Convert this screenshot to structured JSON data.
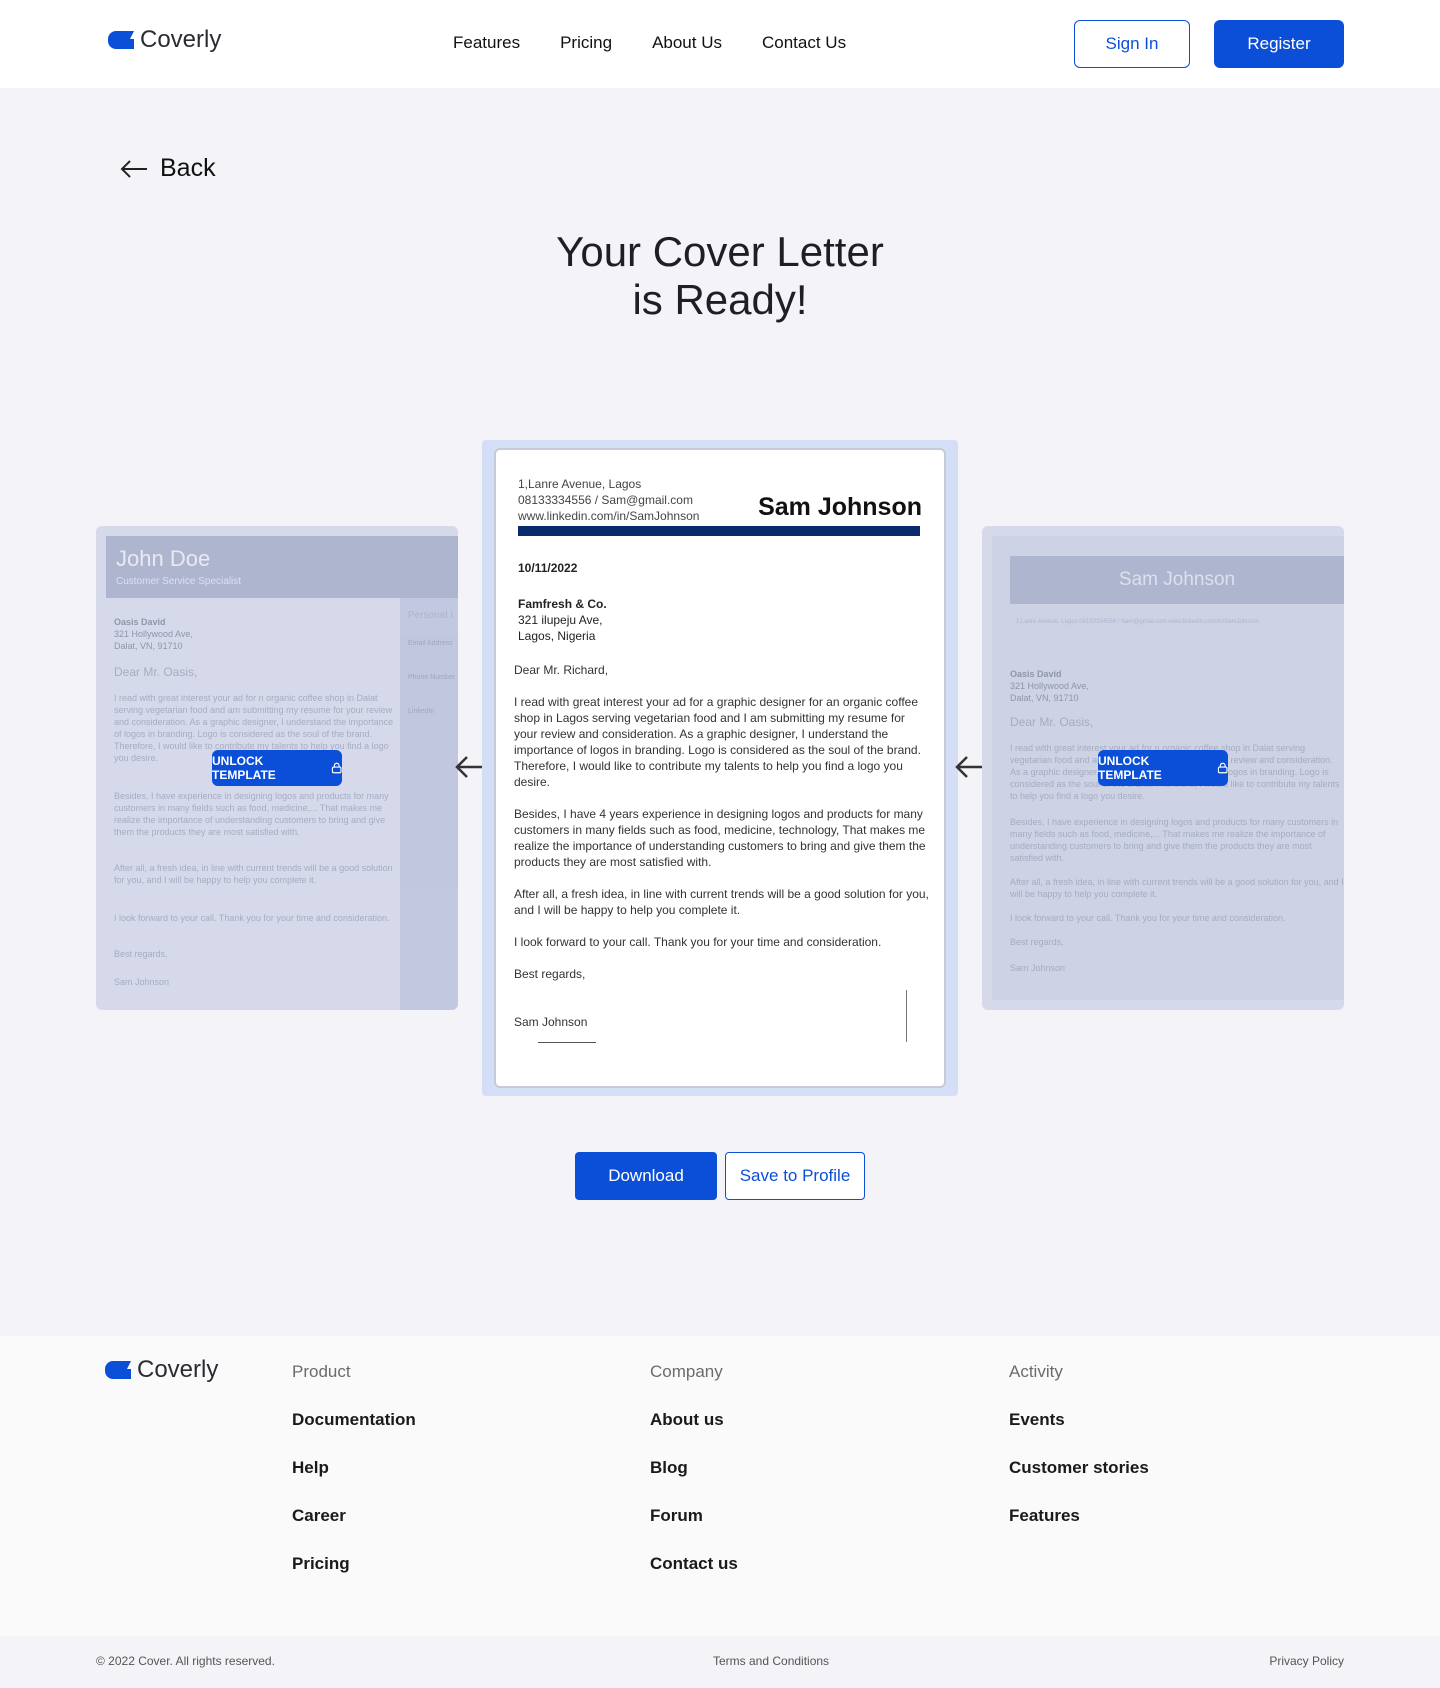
{
  "header": {
    "brand": "Coverly",
    "nav": [
      "Features",
      "Pricing",
      "About Us",
      "Contact Us"
    ],
    "sign_in": "Sign In",
    "register": "Register"
  },
  "page": {
    "back": "Back",
    "title_line1": "Your Cover Letter",
    "title_line2": "is Ready!"
  },
  "left_template": {
    "name": "John Doe",
    "role": "Customer Service Specialist",
    "side_heading": "Personal I",
    "side_fields": [
      "Email Address",
      "Phone Number",
      "LinkedIn"
    ],
    "recipient": [
      "Oasis David",
      "321 Hollywood Ave,",
      "Dalat, VN, 91710"
    ],
    "greeting": "Dear Mr. Oasis,",
    "paras": [
      "I read with great interest your ad for n organic coffee shop in Dalat serving vegetarian food and am submitting my resume for your review and consideration. As a graphic designer, I understand the importance of logos in branding. Logo is considered as the soul of the brand. Therefore, I would like to contribute my talents to help you find a logo you desire.",
      "Besides, I have experience in designing logos and products for many customers in many fields such as food, medicine,... That makes me realize the importance of understanding customers to bring and give them the products they are most satisfied with.",
      "After all, a fresh idea, in line with current trends will be a good solution for you, and I will be happy to help you complete it.",
      "I look forward to your call. Thank you for your time and consideration."
    ],
    "closing": "Best regards,",
    "signature": "Sam Johnson",
    "unlock": "UNLOCK TEMPLATE"
  },
  "right_template": {
    "name": "Sam Johnson",
    "contact": "1,Lanre Avenue, Lagos  08133334556 / Sam@gmail.com  www.linkedin.com/in/SamJohnson",
    "recipient": [
      "Oasis David",
      "321 Hollywood Ave,",
      "Dalat, VN, 91710"
    ],
    "greeting": "Dear Mr. Oasis,",
    "paras": [
      "I read with great interest your ad for n organic coffee shop in Dalat serving vegetarian food and am submitting my resume for your review and consideration. As a graphic designer, I understand the importance of logos in branding. Logo is considered as the soul of the brand. Therefore, I would like to contribute my talents to help you find a logo you desire.",
      "Besides, I have experience in designing logos and products for many customers in many fields such as food, medicine,... That makes me realize the importance of understanding customers to bring and give them the products they are most satisfied with.",
      "After all, a fresh idea, in line with current trends will be a good solution for you, and I will be happy to help you complete it.",
      "I look forward to your call. Thank you for your time and consideration."
    ],
    "closing": "Best regards,",
    "signature": "Sam Johnson",
    "unlock": "UNLOCK TEMPLATE"
  },
  "letter": {
    "address": "1,Lanre Avenue, Lagos",
    "phone_email": "08133334556 / Sam@gmail.com",
    "linkedin": "www.linkedin.com/in/SamJohnson",
    "name": "Sam Johnson",
    "date": "10/11/2022",
    "company": "Famfresh & Co.",
    "company_street": "321 ilupeju  Ave,",
    "company_city": "Lagos, Nigeria",
    "greeting": "Dear Mr. Richard,",
    "p1": "I read with great interest your ad for a graphic designer for an organic coffee shop in Lagos serving vegetarian food and I am submitting my resume for your review and consideration. As a graphic designer, I understand the importance of logos in branding. Logo is considered as the soul of the brand. Therefore, I would like to contribute my talents to help you find a logo you desire.",
    "p2": "Besides, I have 4 years experience in designing logos and products for many customers in many fields such as food, medicine, technology, That makes me realize the importance of understanding customers to bring and give them the products they are most satisfied with.",
    "p3": "After all, a fresh idea, in line with current trends will be a good solution for you, and I will be happy to help you complete it.",
    "p4": "I look forward to your call. Thank you for your time and consideration.",
    "closing": "Best regards,",
    "signature": "Sam Johnson"
  },
  "actions": {
    "download": "Download",
    "save": "Save to Profile"
  },
  "footer": {
    "brand": "Coverly",
    "columns": [
      {
        "heading": "Product",
        "items": [
          "Documentation",
          "Help",
          "Career",
          "Pricing"
        ]
      },
      {
        "heading": "Company",
        "items": [
          "About us",
          "Blog",
          "Forum",
          "Contact us"
        ]
      },
      {
        "heading": "Activity",
        "items": [
          "Events",
          "Customer stories",
          "Features"
        ]
      }
    ],
    "copyright": "© 2022 Cover. All rights reserved.",
    "terms": "Terms and Conditions",
    "privacy": "Privacy Policy"
  },
  "colors": {
    "accent": "#0b4fd9",
    "letter_rule": "#0a2a6b",
    "page_bg": "#f3f3f8"
  }
}
